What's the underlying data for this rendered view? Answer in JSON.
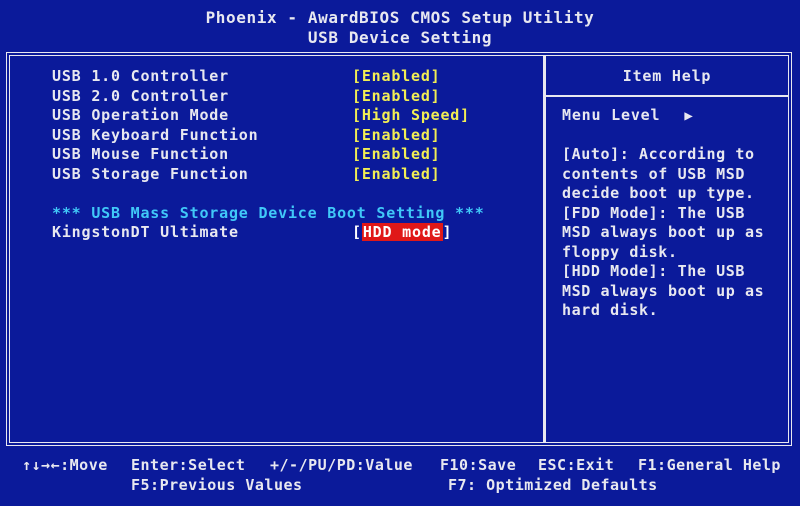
{
  "header": {
    "title": "Phoenix - AwardBIOS CMOS Setup Utility",
    "subtitle": "USB Device Setting"
  },
  "settings": [
    {
      "label": "USB 1.0 Controller",
      "value": "[Enabled]"
    },
    {
      "label": "USB 2.0 Controller",
      "value": "[Enabled]"
    },
    {
      "label": "USB Operation Mode",
      "value": "[High Speed]"
    },
    {
      "label": "USB Keyboard Function",
      "value": "[Enabled]"
    },
    {
      "label": "USB Mouse Function",
      "value": "[Enabled]"
    },
    {
      "label": "USB Storage Function",
      "value": "[Enabled]"
    }
  ],
  "section": {
    "title": "*** USB Mass Storage Device Boot Setting ***"
  },
  "device": {
    "label": "KingstonDT Ultimate",
    "bracket_open": "[",
    "value": "HDD mode",
    "bracket_close": "]"
  },
  "help": {
    "title": "Item Help",
    "menu_level": "Menu Level",
    "menu_arrow": "▶",
    "lines": [
      "[Auto]: According to",
      "contents of USB MSD",
      "decide boot up type.",
      "[FDD Mode]: The USB",
      "MSD always boot up as",
      "floppy disk.",
      "[HDD Mode]: The USB",
      "MSD always boot up as",
      "hard disk."
    ]
  },
  "footer": {
    "move": "↑↓→←:Move",
    "enter": "Enter:Select",
    "value": "+/-/PU/PD:Value",
    "save": "F10:Save",
    "exit": "ESC:Exit",
    "help": "F1:General Help",
    "previous": "F5:Previous Values",
    "defaults": "F7: Optimized Defaults"
  },
  "colors": {
    "background": "#0b1a9a",
    "text": "#e8e8f0",
    "value": "#f2ee54",
    "section": "#40c8f8",
    "highlight": "#e01818"
  }
}
